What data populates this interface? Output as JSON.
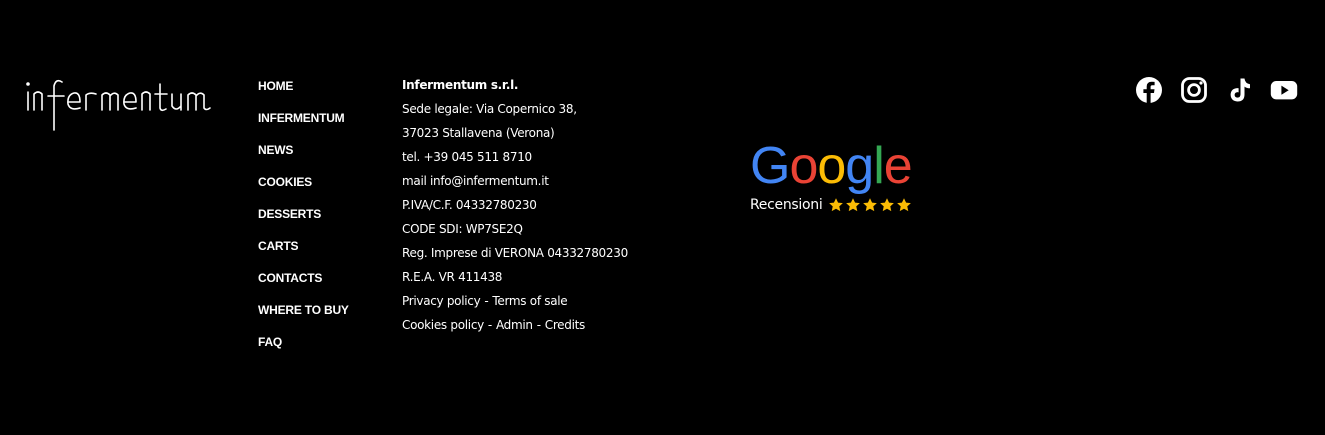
{
  "brand": {
    "logo_text": "infermentum"
  },
  "nav": {
    "items": [
      {
        "label": "HOME"
      },
      {
        "label": "INFERMENTUM"
      },
      {
        "label": "NEWS"
      },
      {
        "label": "COOKIES"
      },
      {
        "label": "DESSERTS"
      },
      {
        "label": "CARTS"
      },
      {
        "label": "CONTACTS"
      },
      {
        "label": "WHERE TO BUY"
      },
      {
        "label": "FAQ"
      }
    ]
  },
  "company": {
    "name": "Infermentum s.r.l.",
    "address_line1": "Sede legale: Via Copernico 38,",
    "address_line2": "37023 Stallavena (Verona)",
    "phone": "tel. +39 045 511 8710",
    "email": "mail info@infermentum.it",
    "vat": "P.IVA/C.F. 04332780230",
    "sdi": "CODE SDI: WP7SE2Q",
    "register": "Reg. Imprese di VERONA 04332780230",
    "rea": "R.E.A. VR 411438"
  },
  "legal": {
    "privacy_label": "Privacy policy",
    "terms_label": "Terms of sale",
    "cookies_label": "Cookies policy",
    "admin_label": "Admin",
    "credits_label": "Credits",
    "separator": "-"
  },
  "reviews": {
    "brand_letters": [
      "G",
      "o",
      "o",
      "g",
      "l",
      "e"
    ],
    "brand_colors": [
      "#4285F4",
      "#EA4335",
      "#FBBC05",
      "#4285F4",
      "#34A853",
      "#EA4335"
    ],
    "label": "Recensioni",
    "rating_stars": 5,
    "star_color": "#FBBC05"
  },
  "social": {
    "icons": [
      "facebook-icon",
      "instagram-icon",
      "tiktok-icon",
      "youtube-icon"
    ]
  }
}
